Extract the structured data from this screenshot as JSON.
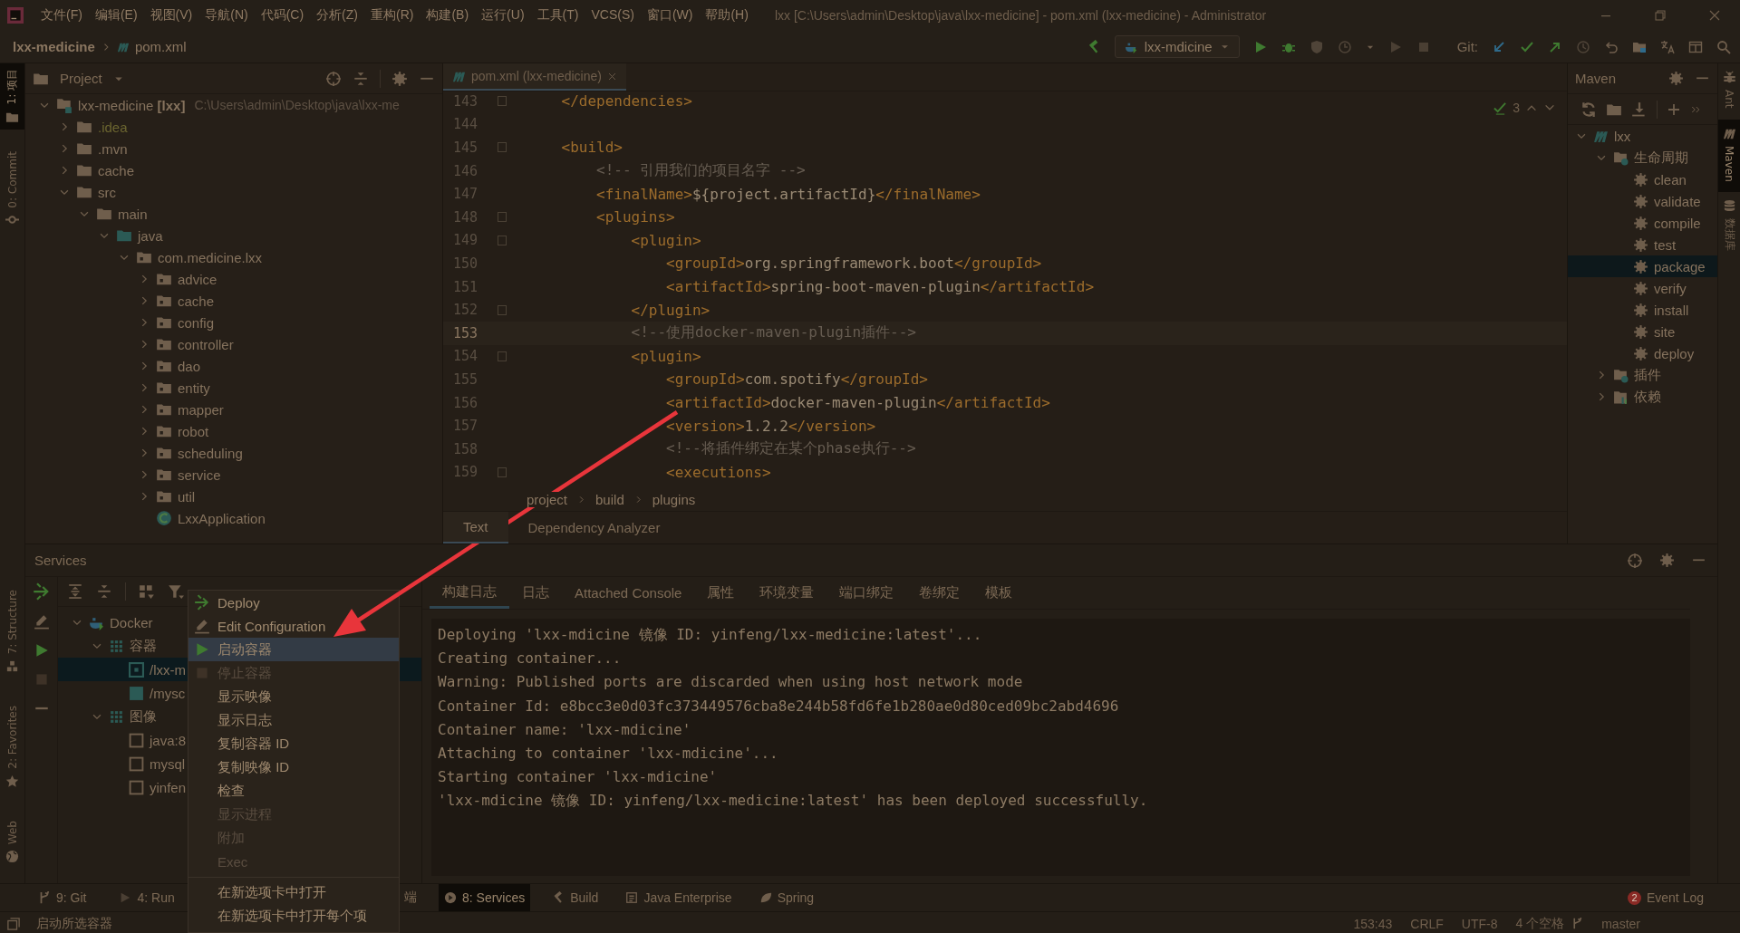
{
  "window": {
    "title": "lxx [C:\\Users\\admin\\Desktop\\java\\lxx-medicine] - pom.xml (lxx-medicine) - Administrator"
  },
  "menu": [
    "文件(F)",
    "编辑(E)",
    "视图(V)",
    "导航(N)",
    "代码(C)",
    "分析(Z)",
    "重构(R)",
    "构建(B)",
    "运行(U)",
    "工具(T)",
    "VCS(S)",
    "窗口(W)",
    "帮助(H)"
  ],
  "navigation": {
    "project": "lxx-medicine",
    "file": "pom.xml",
    "run_config": "lxx-mdicine",
    "git_label": "Git:"
  },
  "left_stripe": {
    "top": [
      {
        "label": "1: 项目",
        "kind": "folder",
        "selected": true
      },
      {
        "label": "0: Commit",
        "kind": "commit",
        "selected": false
      }
    ],
    "bottom": [
      {
        "label": "7: Structure",
        "kind": "structure",
        "selected": false
      },
      {
        "label": "2: Favorites",
        "kind": "star",
        "selected": false
      },
      {
        "label": "Web",
        "kind": "globe",
        "selected": false
      }
    ]
  },
  "right_stripe": [
    {
      "label": "Ant",
      "kind": "ant",
      "selected": false
    },
    {
      "label": "Maven",
      "kind": "maven",
      "selected": true
    },
    {
      "label": "数据库",
      "kind": "database",
      "selected": false
    }
  ],
  "project": {
    "title": "Project",
    "tree": [
      {
        "label": "lxx-medicine **[lxx]**",
        "detail": "C:\\Users\\admin\\Desktop\\java\\lxx-me",
        "kind": "module",
        "expanded": true,
        "ignored": false,
        "children": [
          {
            "label": ".idea",
            "kind": "folder",
            "expanded": false,
            "ignored": true
          },
          {
            "label": ".mvn",
            "kind": "folder",
            "expanded": false,
            "ignored": false
          },
          {
            "label": "cache",
            "kind": "folder",
            "expanded": false,
            "ignored": false
          },
          {
            "label": "src",
            "kind": "folder",
            "expanded": true,
            "ignored": false,
            "children": [
              {
                "label": "main",
                "kind": "folder",
                "expanded": true,
                "ignored": false,
                "children": [
                  {
                    "label": "java",
                    "kind": "source",
                    "expanded": true,
                    "ignored": false,
                    "children": [
                      {
                        "label": "com.medicine.lxx",
                        "kind": "package",
                        "expanded": true,
                        "ignored": false,
                        "children": [
                          {
                            "label": "advice",
                            "kind": "package",
                            "expanded": false,
                            "ignored": false
                          },
                          {
                            "label": "cache",
                            "kind": "package",
                            "expanded": false,
                            "ignored": false
                          },
                          {
                            "label": "config",
                            "kind": "package",
                            "expanded": false,
                            "ignored": false
                          },
                          {
                            "label": "controller",
                            "kind": "package",
                            "expanded": false,
                            "ignored": false
                          },
                          {
                            "label": "dao",
                            "kind": "package",
                            "expanded": false,
                            "ignored": false
                          },
                          {
                            "label": "entity",
                            "kind": "package",
                            "expanded": false,
                            "ignored": false
                          },
                          {
                            "label": "mapper",
                            "kind": "package",
                            "expanded": false,
                            "ignored": false
                          },
                          {
                            "label": "robot",
                            "kind": "package",
                            "expanded": false,
                            "ignored": false
                          },
                          {
                            "label": "scheduling",
                            "kind": "package",
                            "expanded": false,
                            "ignored": false
                          },
                          {
                            "label": "service",
                            "kind": "package",
                            "expanded": false,
                            "ignored": false
                          },
                          {
                            "label": "util",
                            "kind": "package",
                            "expanded": false,
                            "ignored": false
                          },
                          {
                            "label": "LxxApplication",
                            "kind": "class",
                            "ignored": false
                          }
                        ]
                      }
                    ]
                  }
                ]
              }
            ]
          }
        ]
      }
    ]
  },
  "editor": {
    "tab": "pom.xml (lxx-medicine)",
    "problems": "3",
    "lines": [
      {
        "number": "143",
        "current": false,
        "fold": true,
        "tokens": [
          {
            "kind": "tag",
            "text": "</dependencies>"
          }
        ]
      },
      {
        "number": "144",
        "current": false,
        "fold": false
      },
      {
        "number": "145",
        "current": false,
        "fold": true,
        "tokens": [
          {
            "kind": "tag",
            "text": "<build>"
          }
        ],
        "children": [
          {
            "number": "146",
            "current": false,
            "fold": false,
            "tokens": [
              {
                "kind": "comment",
                "text": "<!-- 引用我们的项目名字 -->"
              }
            ]
          },
          {
            "number": "147",
            "current": false,
            "fold": false,
            "tokens": [
              {
                "kind": "tag",
                "text": "<finalName>"
              },
              {
                "kind": "text",
                "text": "${project.artifactId}"
              },
              {
                "kind": "tag",
                "text": "</finalName>"
              }
            ]
          },
          {
            "number": "148",
            "current": false,
            "fold": true,
            "tokens": [
              {
                "kind": "tag",
                "text": "<plugins>"
              }
            ],
            "children": [
              {
                "number": "149",
                "current": false,
                "fold": true,
                "tokens": [
                  {
                    "kind": "tag",
                    "text": "<plugin>"
                  }
                ],
                "children": [
                  {
                    "number": "150",
                    "current": false,
                    "fold": false,
                    "tokens": [
                      {
                        "kind": "tag",
                        "text": "<groupId>"
                      },
                      {
                        "kind": "text",
                        "text": "org.springframework.boot"
                      },
                      {
                        "kind": "tag",
                        "text": "</groupId>"
                      }
                    ]
                  },
                  {
                    "number": "151",
                    "current": false,
                    "fold": false,
                    "tokens": [
                      {
                        "kind": "tag",
                        "text": "<artifactId>"
                      },
                      {
                        "kind": "text",
                        "text": "spring-boot-maven-plugin"
                      },
                      {
                        "kind": "tag",
                        "text": "</artifactId>"
                      }
                    ]
                  }
                ]
              },
              {
                "number": "152",
                "current": false,
                "fold": true,
                "tokens": [
                  {
                    "kind": "tag",
                    "text": "</plugin>"
                  }
                ]
              },
              {
                "number": "153",
                "current": true,
                "fold": false,
                "tokens": [
                  {
                    "kind": "comment",
                    "text": "<!--使用docker-maven-plugin插件-->"
                  }
                ]
              },
              {
                "number": "154",
                "current": false,
                "fold": true,
                "tokens": [
                  {
                    "kind": "tag",
                    "text": "<plugin>"
                  }
                ],
                "children": [
                  {
                    "number": "155",
                    "current": false,
                    "fold": false,
                    "tokens": [
                      {
                        "kind": "tag",
                        "text": "<groupId>"
                      },
                      {
                        "kind": "text",
                        "text": "com.spotify"
                      },
                      {
                        "kind": "tag",
                        "text": "</groupId>"
                      }
                    ]
                  },
                  {
                    "number": "156",
                    "current": false,
                    "fold": false,
                    "tokens": [
                      {
                        "kind": "tag",
                        "text": "<artifactId>"
                      },
                      {
                        "kind": "text",
                        "text": "docker-maven-plugin"
                      },
                      {
                        "kind": "tag",
                        "text": "</artifactId>"
                      }
                    ]
                  },
                  {
                    "number": "157",
                    "current": false,
                    "fold": false,
                    "tokens": [
                      {
                        "kind": "tag",
                        "text": "<version>"
                      },
                      {
                        "kind": "text",
                        "text": "1.2.2"
                      },
                      {
                        "kind": "tag",
                        "text": "</version>"
                      }
                    ]
                  },
                  {
                    "number": "158",
                    "current": false,
                    "fold": false,
                    "tokens": [
                      {
                        "kind": "comment",
                        "text": "<!--将插件绑定在某个phase执行-->"
                      }
                    ]
                  },
                  {
                    "number": "159",
                    "current": false,
                    "fold": true,
                    "tokens": [
                      {
                        "kind": "tag",
                        "text": "<executions>"
                      }
                    ]
                  }
                ]
              }
            ]
          }
        ]
      }
    ],
    "breadcrumb": [
      "project",
      "build",
      "plugins"
    ],
    "bottom_tabs": [
      {
        "label": "Text",
        "selected": true
      },
      {
        "label": "Dependency Analyzer",
        "selected": false
      }
    ]
  },
  "maven": {
    "title": "Maven",
    "tree": [
      {
        "label": "lxx",
        "kind": "module",
        "expanded": true,
        "selected": false,
        "children": [
          {
            "label": "生命周期",
            "kind": "lifecycle",
            "expanded": true,
            "selected": false,
            "children": [
              {
                "label": "clean",
                "kind": "goal",
                "selected": false
              },
              {
                "label": "validate",
                "kind": "goal",
                "selected": false
              },
              {
                "label": "compile",
                "kind": "goal",
                "selected": false
              },
              {
                "label": "test",
                "kind": "goal",
                "selected": false
              },
              {
                "label": "package",
                "kind": "goal",
                "selected": true
              },
              {
                "label": "verify",
                "kind": "goal",
                "selected": false
              },
              {
                "label": "install",
                "kind": "goal",
                "selected": false
              },
              {
                "label": "site",
                "kind": "goal",
                "selected": false
              },
              {
                "label": "deploy",
                "kind": "goal",
                "selected": false
              }
            ]
          },
          {
            "label": "插件",
            "kind": "plugins",
            "expanded": false,
            "selected": false
          },
          {
            "label": "依赖",
            "kind": "deps",
            "expanded": false,
            "selected": false
          }
        ]
      }
    ]
  },
  "services": {
    "title": "Services",
    "tree": [
      {
        "label": "Docker",
        "kind": "docker",
        "expanded": true,
        "selected": false,
        "children": [
          {
            "label": "容器",
            "kind": "group",
            "expanded": true,
            "selected": false,
            "children": [
              {
                "label": "/lxx-m",
                "kind": "running",
                "selected": true
              },
              {
                "label": "/mysc",
                "kind": "container",
                "selected": false
              }
            ]
          },
          {
            "label": "图像",
            "kind": "group",
            "expanded": true,
            "selected": false,
            "children": [
              {
                "label": "java:8",
                "kind": "image",
                "selected": false
              },
              {
                "label": "mysql",
                "kind": "image",
                "selected": false
              },
              {
                "label": "yinfen",
                "kind": "image",
                "selected": false
              }
            ]
          }
        ]
      }
    ],
    "tabs": [
      {
        "label": "构建日志",
        "selected": true
      },
      {
        "label": "日志",
        "selected": false
      },
      {
        "label": "Attached Console",
        "selected": false
      },
      {
        "label": "属性",
        "selected": false
      },
      {
        "label": "环境变量",
        "selected": false
      },
      {
        "label": "端口绑定",
        "selected": false
      },
      {
        "label": "卷绑定",
        "selected": false
      },
      {
        "label": "模板",
        "selected": false
      }
    ],
    "console": [
      "Deploying 'lxx-mdicine 镜像 ID: yinfeng/lxx-medicine:latest'...",
      "Creating container...",
      "Warning: Published ports are discarded when using host network mode",
      "Container Id: e8bcc3e0d03fc373449576cba8e244b58fd6fe1b280ae0d80ced09bc2abd4696",
      "Container name: 'lxx-mdicine'",
      "Attaching to container 'lxx-mdicine'...",
      "Starting container 'lxx-mdicine'",
      "'lxx-mdicine 镜像 ID: yinfeng/lxx-medicine:latest' has been deployed successfully."
    ]
  },
  "context_menu": [
    {
      "label": "Deploy",
      "kind": "deploy",
      "selected": false,
      "disabled": false
    },
    {
      "label": "Edit Configuration",
      "kind": "edit",
      "selected": false,
      "disabled": false
    },
    {
      "label": "启动容器",
      "kind": "start",
      "selected": true,
      "disabled": false
    },
    {
      "label": "停止容器",
      "kind": "stop",
      "selected": false,
      "disabled": true
    },
    {
      "label": "显示映像",
      "kind": "plain",
      "selected": false,
      "disabled": false
    },
    {
      "label": "显示日志",
      "kind": "plain",
      "selected": false,
      "disabled": false
    },
    {
      "label": "复制容器 ID",
      "kind": "plain",
      "selected": false,
      "disabled": false
    },
    {
      "label": "复制映像 ID",
      "kind": "plain",
      "selected": false,
      "disabled": false
    },
    {
      "label": "检查",
      "kind": "plain",
      "selected": false,
      "disabled": false
    },
    {
      "label": "显示进程",
      "kind": "plain",
      "selected": false,
      "disabled": true
    },
    {
      "label": "附加",
      "kind": "plain",
      "selected": false,
      "disabled": true
    },
    {
      "label": "Exec",
      "kind": "plain",
      "selected": false,
      "disabled": true
    },
    {
      "kind": "separator"
    },
    {
      "label": "在新选项卡中打开",
      "kind": "plain",
      "selected": false,
      "disabled": false
    },
    {
      "label": "在新选项卡中打开每个项",
      "kind": "plain",
      "selected": false,
      "disabled": false
    }
  ],
  "tool_windows": {
    "left": [
      {
        "label": "9: Git",
        "kind": "git",
        "selected": false
      },
      {
        "label": "4: Run",
        "kind": "run",
        "selected": false
      }
    ],
    "middle": [
      {
        "label": "端",
        "kind": "none",
        "selected": false
      },
      {
        "label": "8: Services",
        "kind": "services",
        "selected": true
      },
      {
        "label": "Build",
        "kind": "build",
        "selected": false
      },
      {
        "label": "Java Enterprise",
        "kind": "enterprise",
        "selected": false
      },
      {
        "label": "Spring",
        "kind": "spring",
        "selected": false
      }
    ],
    "event_log": {
      "label": "Event Log",
      "badge": "2"
    }
  },
  "status_bar": {
    "message": "启动所选容器",
    "items": [
      "153:43",
      "CRLF",
      "UTF-8",
      "4 个空格",
      "master"
    ]
  }
}
